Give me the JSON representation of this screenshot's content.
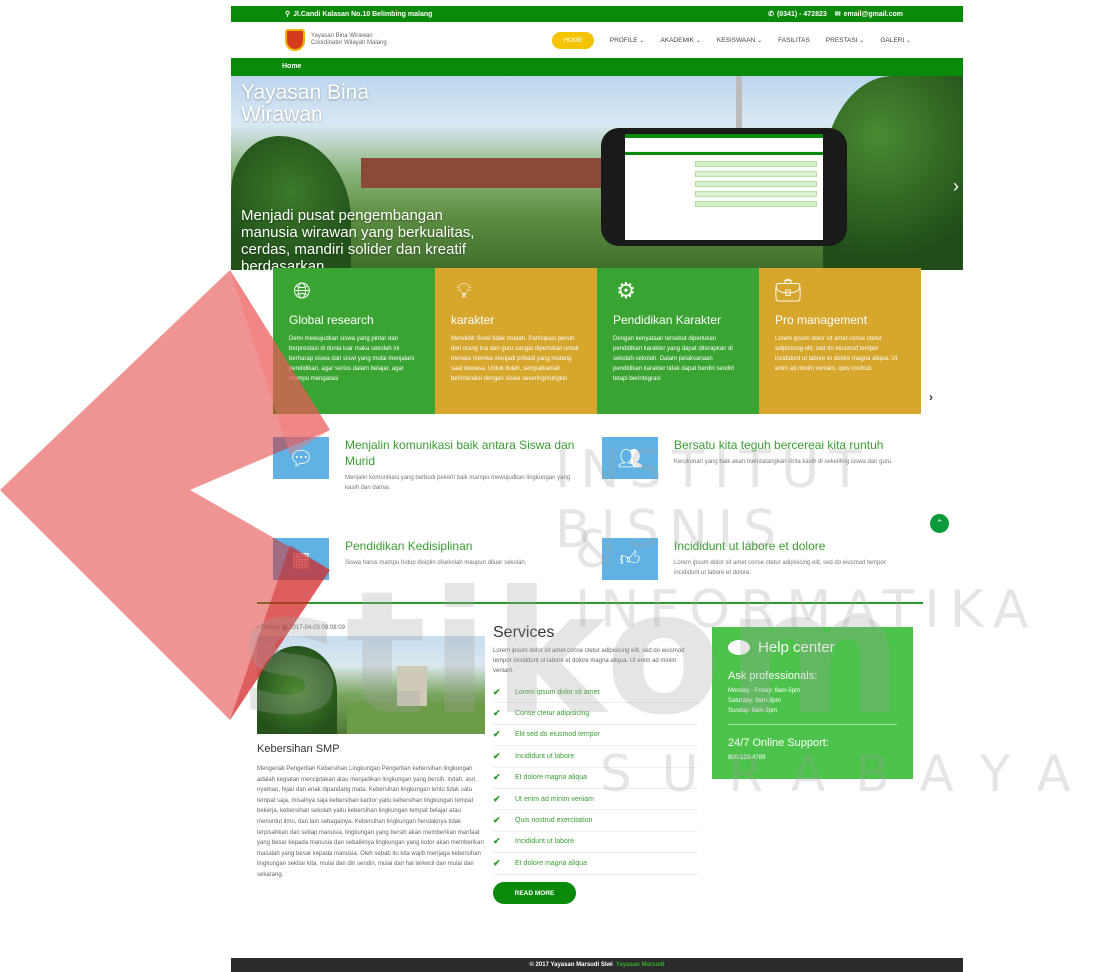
{
  "topbar": {
    "address": "Jl.Candi Kalasan No.10 Belimbing malang",
    "phone": "(0341) - 472823",
    "email": "email@gmail.com"
  },
  "logo": {
    "text": "Yayasan Bina Wirawan Coordinator Wilayah Malang"
  },
  "menu": [
    {
      "label": "HOME",
      "active": true
    },
    {
      "label": "PROFILE"
    },
    {
      "label": "AKADEMIK"
    },
    {
      "label": "KESISWAAN"
    },
    {
      "label": "FASILITAS"
    },
    {
      "label": "PRESTASI"
    },
    {
      "label": "GALERI"
    }
  ],
  "breadcrumb": "Home",
  "hero": {
    "title": "Yayasan Bina Wirawan",
    "caption": "Menjadi pusat pengembangan manusia wirawan yang berkualitas, cerdas, mandiri solider dan kreatif berdasarkan"
  },
  "features": [
    {
      "icon": "globe-icon",
      "title": "Global research",
      "text": "Demi mewujudkan siswa yang pintar dan berprestasi di dunia luar maka sekolah ini berharap siswa dan siswi yang mulai menjalani pendidikan, agar serius dalam belajar, agar mampu mengatasi",
      "color": "green"
    },
    {
      "icon": "lightbulb-icon",
      "title": "karakter",
      "text": "Mendidik Siswi tidak mudah. Partisipasi penuh dari orang tua dan guru sangat diperlukan untuk menata mereka menjadi pribadi yang matang saat dewasa. Untuk itulah, sempatkanlah berinteraksi dengan siswa seseringmungkin",
      "color": "gold"
    },
    {
      "icon": "gear-icon",
      "title": "Pendidikan Karakter",
      "text": "Dengan kenyataan tersebut diperlukan pendidikan karakter yang dapat diterapkan di sekolah-sekolah. Dalam pelaksanaan pendidikan karakter tidak dapat berdiri sendiri tetapi berintegrasi",
      "color": "green"
    },
    {
      "icon": "briefcase-icon",
      "title": "Pro management",
      "text": "Lorem ipsum dolor sit amet conse ctetur adipisicing elit, sed do eiusmod tempor incididunt ut labore et dolore magna aliqua. Ut enim ad minim veniam, quis nostrud.",
      "color": "gold"
    }
  ],
  "missions": [
    {
      "icon": "chat-icon",
      "title": "Menjalin komunikasi baik antara Siswa dan Murid",
      "text": "Menjalin komunikasi yang berbudi pekerti baik mampu mewujudkan lingkungan yang kasih dan damai."
    },
    {
      "icon": "group-icon",
      "title": "Bersatu kita teguh bercereai kita runtuh",
      "text": "Kerukunan yang baik akan mendatangkan cinta kasih di sekeliling siswa dan guru."
    },
    {
      "icon": "calendar-icon",
      "title": "Pendidikan Kedisiplinan",
      "text": "Siswa harus mampu hidup disiplin disekolah maupun diluar sekolah."
    },
    {
      "icon": "thumbs-up-icon",
      "title": "Incididunt ut labore et dolore",
      "text": "Lorem ipsum dolor sit amet conse ctetur adipisicing elit, sed do eiusmod tempor incididunt ut labore et dolore."
    }
  ],
  "post": {
    "author": "Defaria",
    "date": "2017-04-03",
    "time": "09:08:09",
    "title": "Kebersihan SMP",
    "body": "Mengenali Pengertian Kebersihan Lingkungan Pengertian kebersihan lingkungan adalah kegiatan menciptakan atau menjadikan lingkungan yang bersih, indah, asri, nyaman, hijau dan enak dipandang mata. Kebersihan lingkungan tentu tidak satu tempat saja, misalnya saja kebersihan kantor yaitu kebersihan lingkungan tempat bekerja, kebersihan sekolah yaitu kebersihan lingkungan tempat belajar atau menuntut ilmu, dan lain sebagainya. Kebersihan lingkungan hendaknya tidak terpisahkan dari setiap manusia, lingkungan yang bersih akan memberikan manfaat yang besar kepada manusia dan sebaliknya lingkungan yang kotor akan memberikan masalah yang besar kepada manusia. Oleh sebab itu kita wajib menjaga kebersihan lingkungan sekitar kita, mulai dari diri sendiri, mulai dari hal terkecil dan mulai dari sekarang."
  },
  "services": {
    "title": "Services",
    "desc": "Lorem ipsum dolor sit amet conse ctetur adipisicing elit, sed do eiusmod tempor incididunt ut labore et dolore magna aliqua. Ut enim ad minim veniam.",
    "items": [
      "Lorem ipsum dolor sit amet",
      "Conse ctetur adipisicing",
      "Elit sed do eiusmod tempor",
      "Incididunt ut labore",
      "Et dolore magna aliqua",
      "Ut enim ad minim veniam",
      "Quis nostrud exercitation",
      "Incididunt ut labore",
      "Et dolore magna aliqua"
    ],
    "read_more": "READ MORE"
  },
  "help": {
    "title": "Help center",
    "ask": "Ask professionals:",
    "lines": [
      "Monday - Friday: 8am-5pm",
      "Saturday: 8am-3pm",
      "Sunday: 9am-3pm"
    ],
    "support_title": "24/7 Online Support:",
    "support_phone": "800-123-4789"
  },
  "footer": {
    "text": "© 2017 Yayasan Marsudi Siwi",
    "link": "Yayasan Marsudi"
  },
  "watermark": {
    "line1": "INSTITUT BISNIS",
    "line2": "& INFORMATIKA",
    "line3": "stikom",
    "line4": "SURABAYA"
  },
  "colors": {
    "brand_green": "#0a8a0a",
    "feature_green": "#3aa432",
    "feature_gold": "#d7a62c",
    "accent_yellow": "#f5c400",
    "icon_blue": "#5fb2e3",
    "help_green": "#4cc34a"
  }
}
